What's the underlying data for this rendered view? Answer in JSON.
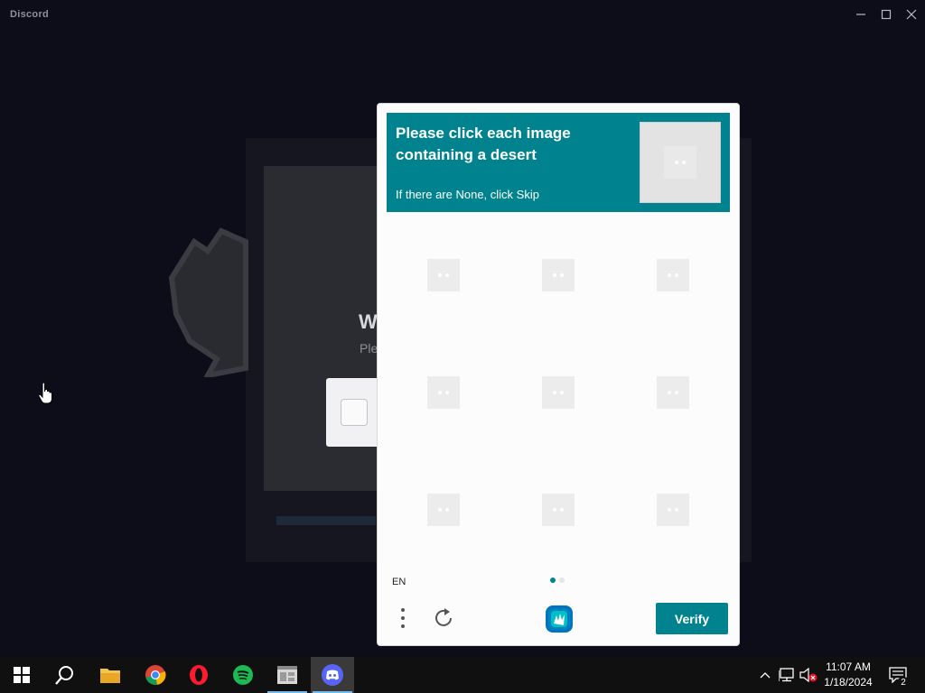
{
  "window": {
    "title": "Discord",
    "controls": [
      "minimize-icon",
      "maximize-icon",
      "close-icon"
    ]
  },
  "background_login": {
    "heading_fragment": "W",
    "subtext_fragment": "Ple"
  },
  "challenge": {
    "prompt": "Please click each image containing a desert",
    "hint": "If there are None, click Skip",
    "grid_cells": [
      {
        "index": 1,
        "selected": false
      },
      {
        "index": 2,
        "selected": false
      },
      {
        "index": 3,
        "selected": false
      },
      {
        "index": 4,
        "selected": false
      },
      {
        "index": 5,
        "selected": false
      },
      {
        "index": 6,
        "selected": false
      },
      {
        "index": 7,
        "selected": false
      },
      {
        "index": 8,
        "selected": false
      },
      {
        "index": 9,
        "selected": false
      }
    ],
    "language": "EN",
    "page_indicator": {
      "pages": 2,
      "current": 1
    },
    "verify_label": "Verify",
    "colors": {
      "accent": "#00838f",
      "active_dot": "#00838f",
      "inactive_dot": "#e6e6e6"
    }
  },
  "taskbar": {
    "items": [
      {
        "name": "start-icon"
      },
      {
        "name": "search-icon"
      },
      {
        "name": "file-explorer-icon"
      },
      {
        "name": "chrome-icon"
      },
      {
        "name": "opera-icon"
      },
      {
        "name": "spotify-icon"
      },
      {
        "name": "app-window-icon"
      },
      {
        "name": "discord-icon",
        "active": true
      }
    ],
    "tray": {
      "time": "11:07 AM",
      "date": "1/18/2024",
      "notifications": "2"
    }
  }
}
